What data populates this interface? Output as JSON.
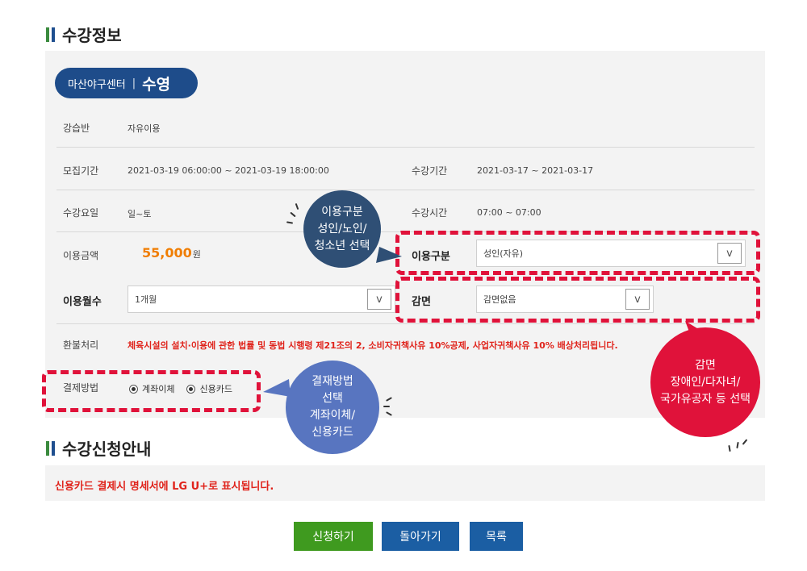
{
  "sections": {
    "course_info_title": "수강정보",
    "application_guide_title": "수강신청안내"
  },
  "center": {
    "name": "마산야구센터",
    "separator": "|",
    "sport": "수영"
  },
  "fields": {
    "class_label": "강습반",
    "class_value": "자유이용",
    "recruit_period_label": "모집기간",
    "recruit_period_value": "2021-03-19 06:00:00 ~ 2021-03-19 18:00:00",
    "course_period_label": "수강기간",
    "course_period_value": "2021-03-17 ~ 2021-03-17",
    "course_days_label": "수강요일",
    "course_days_value": "일~토",
    "course_time_label": "수강시간",
    "course_time_value": "07:00 ~ 07:00",
    "fee_label": "이용금액",
    "fee_amount": "55,000",
    "fee_unit": "원",
    "usage_type_label": "이용구분",
    "usage_type_value": "성인(자유)",
    "months_label": "이용월수",
    "months_value": "1개월",
    "discount_label": "감면",
    "discount_value": "감면없음",
    "refund_label": "환불처리",
    "refund_text": "체육시설의 설치·이용에 관한 법률 및 동법 시행령 제21조의 2, 소비자귀책사유 10%공제, 사업자귀책사유 10% 배상처리됩니다.",
    "payment_label": "결제방법",
    "payment_options": [
      "계좌이체",
      "신용카드"
    ]
  },
  "select_arrow": "v",
  "callouts": {
    "usage": [
      "이용구분",
      "성인/노인/",
      "청소년 선택"
    ],
    "payment": [
      "결재방법",
      "선택",
      "계좌이체/",
      "신용카드"
    ],
    "discount": [
      "감면",
      "장애인/다자녀/",
      "국가유공자 등 선택"
    ]
  },
  "notice": "신용카드 결제시 명세서에 LG U+로 표시됩니다.",
  "buttons": {
    "apply": "신청하기",
    "back": "돌아가기",
    "list": "목록"
  },
  "colors": {
    "accent_red": "#e0123a",
    "navy": "#1e4c8a",
    "callout_dark": "#2f4f75",
    "callout_blue": "#5875c0",
    "apply_green": "#3f9a1f",
    "button_blue": "#1b5ea3",
    "price_orange": "#f07d00"
  }
}
